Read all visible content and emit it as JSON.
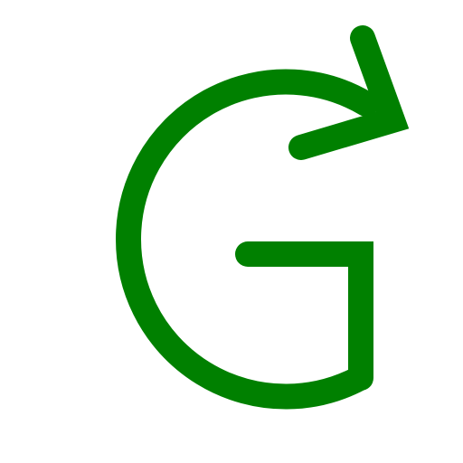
{
  "icon": {
    "name": "refresh-g-icon",
    "stroke_color": "#008000",
    "background_color": "#ffffff"
  }
}
